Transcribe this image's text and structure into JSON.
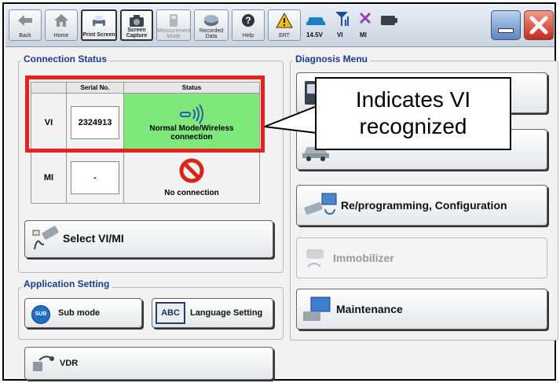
{
  "toolbar": {
    "back": "Back",
    "home": "Home",
    "print_screen": "Print Screen",
    "screen_capture": "Screen\nCapture",
    "measurement_mode": "Measurement\nMode",
    "recorded_data": "Recorded\nData",
    "help": "Help",
    "ert": "ERT",
    "voltage": "14.5V",
    "vi": "VI",
    "mi": "MI"
  },
  "connection_status": {
    "title": "Connection Status",
    "col_serial": "Serial No.",
    "col_status": "Status",
    "rows": [
      {
        "name": "VI",
        "serial": "2324913",
        "status": "Normal Mode/Wireless connection"
      },
      {
        "name": "MI",
        "serial": "-",
        "status": "No connection"
      }
    ],
    "select_button": "Select VI/MI"
  },
  "application_setting": {
    "title": "Application Setting",
    "sub_mode": "Sub mode",
    "sub_icon": "SUB",
    "language": "Language Setting",
    "language_icon": "ABC",
    "vdr": "VDR"
  },
  "diagnosis_menu": {
    "title": "Diagnosis Menu",
    "reprogramming": "Re/programming, Configuration",
    "immobilizer": "Immobilizer",
    "maintenance": "Maintenance"
  },
  "callout": {
    "text": "Indicates VI recognized"
  },
  "colors": {
    "highlight": "#e8211c",
    "connected": "#7ee87a",
    "title": "#1a3c8c"
  }
}
